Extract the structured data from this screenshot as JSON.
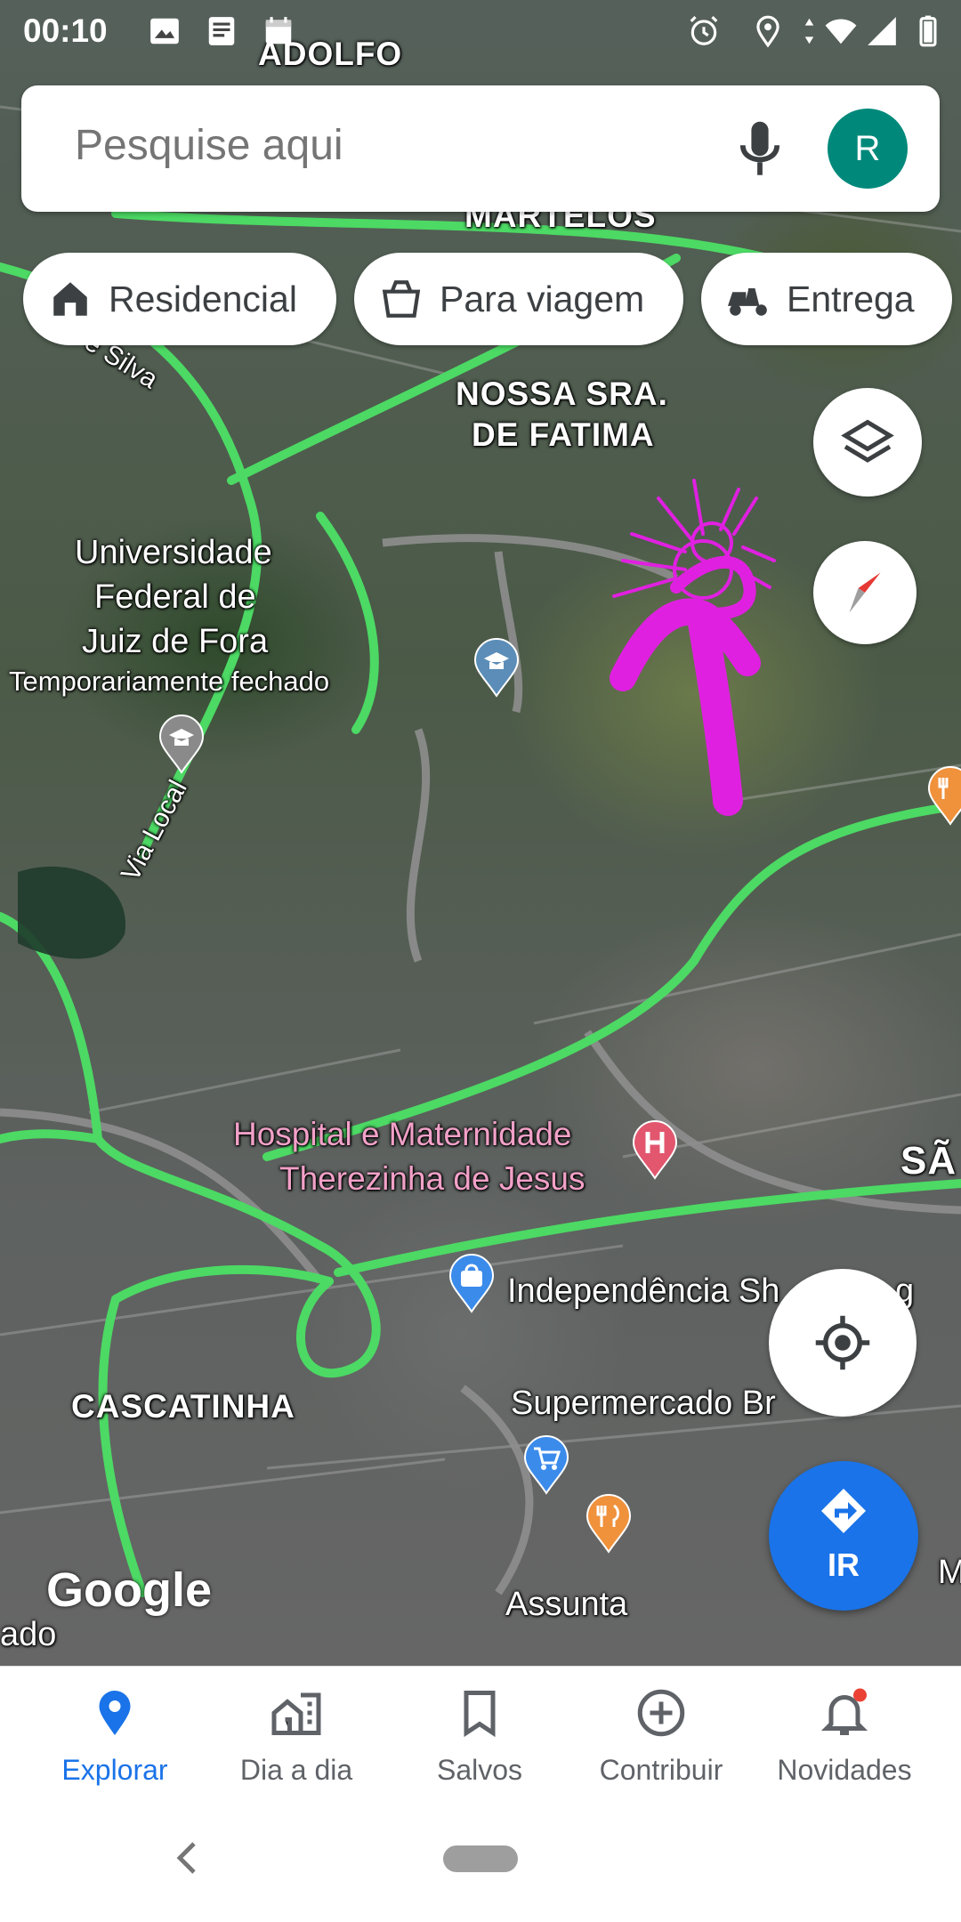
{
  "status_bar": {
    "time": "00:10"
  },
  "search": {
    "placeholder": "Pesquise aqui",
    "avatar_letter": "R"
  },
  "chips": [
    {
      "label": "Residencial",
      "icon": "home-icon"
    },
    {
      "label": "Para viagem",
      "icon": "takeout-bag-icon"
    },
    {
      "label": "Entrega",
      "icon": "delivery-scooter-icon"
    }
  ],
  "map": {
    "labels": {
      "adolfo": "ADOLFO",
      "martelos": "MARTELOS",
      "nossa_sra": "NOSSA SRA.",
      "de_fatima": "DE FATIMA",
      "street_silva": "ta e Silva",
      "ufjf_1": "Universidade",
      "ufjf_2": "Federal de",
      "ufjf_3": "Juiz de Fora",
      "ufjf_status": "Temporariamente fechado",
      "via_local": "Via Local",
      "hospital_1": "Hospital e Maternidade",
      "hospital_2": "Therezinha de Jesus",
      "sao": "SÃ",
      "independencia": "Independência Sh",
      "independencia_tail": "g",
      "cascatinha": "CASCATINHA",
      "supermercado": "Supermercado Br",
      "assunta": "Assunta",
      "ado": "ado",
      "m_edge": "M"
    },
    "google_logo": "Google"
  },
  "actions": {
    "go_label": "IR"
  },
  "colors": {
    "accent": "#1a73e8",
    "traffic_green": "#4cd964",
    "annotation": "#e020e0",
    "avatar": "#00897b"
  },
  "bottom_nav": [
    {
      "label": "Explorar",
      "icon": "explore-pin-icon",
      "active": true
    },
    {
      "label": "Dia a dia",
      "icon": "commute-buildings-icon",
      "active": false
    },
    {
      "label": "Salvos",
      "icon": "bookmark-icon",
      "active": false
    },
    {
      "label": "Contribuir",
      "icon": "add-circle-icon",
      "active": false
    },
    {
      "label": "Novidades",
      "icon": "notification-bell-icon",
      "active": false
    }
  ]
}
